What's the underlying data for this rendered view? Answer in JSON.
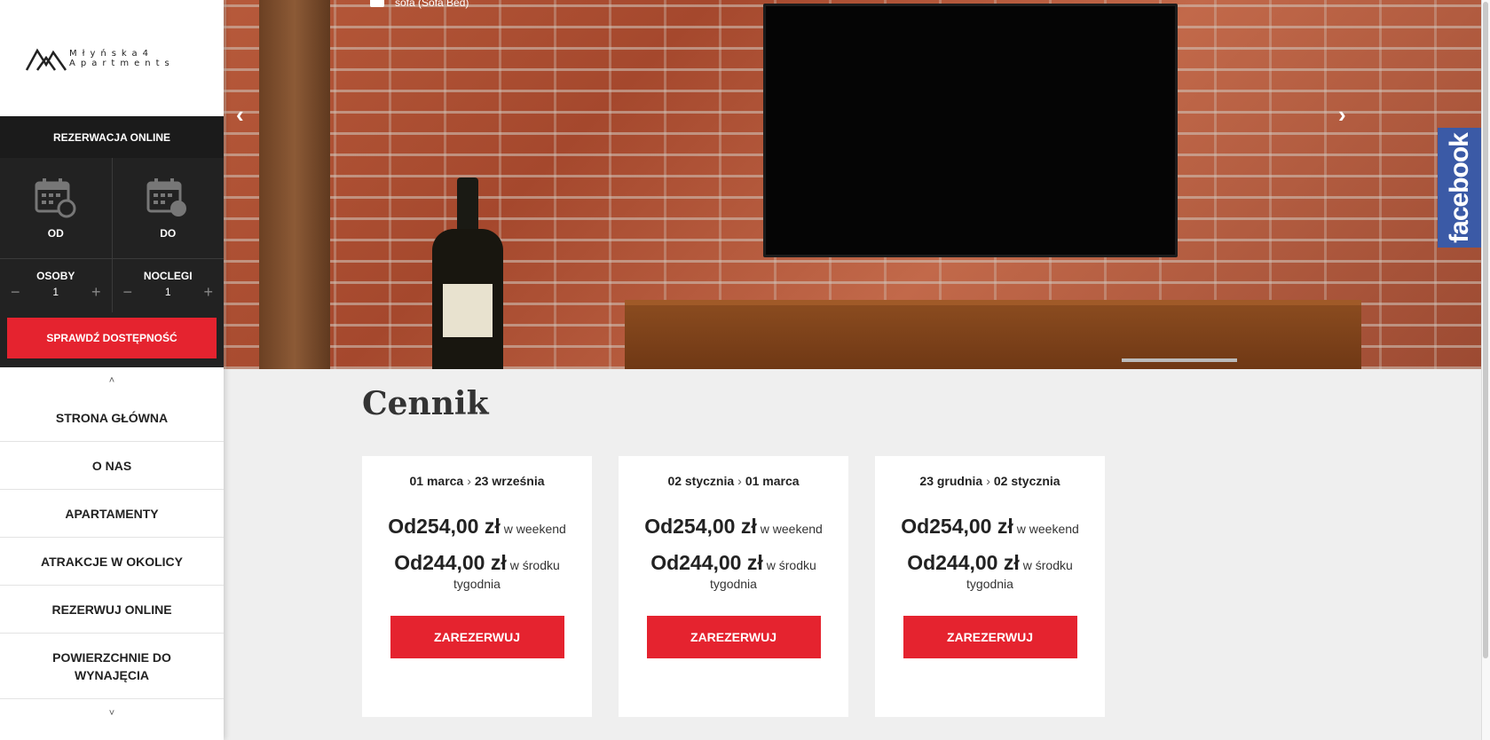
{
  "sidebar": {
    "logo": {
      "line1": "Młyńska4",
      "line2": "Apartments"
    },
    "booking": {
      "header": "REZERWACJA ONLINE",
      "from_label": "OD",
      "to_label": "DO",
      "persons_label": "OSOBY",
      "persons_value": "1",
      "nights_label": "NOCLEGI",
      "nights_value": "1",
      "minus": "−",
      "plus": "+",
      "check_button": "SPRAWDŹ DOSTĘPNOŚĆ"
    },
    "caret_up": "˄",
    "caret_down": "˅",
    "nav": [
      {
        "label": "STRONA GŁÓWNA"
      },
      {
        "label": "O NAS"
      },
      {
        "label": "APARTAMENTY"
      },
      {
        "label": "ATRAKCJE W OKOLICY"
      },
      {
        "label": "REZERWUJ ONLINE"
      },
      {
        "label": "POWIERZCHNIE DO WYNAJĘCIA"
      }
    ]
  },
  "hero": {
    "caption": "sofa (Sofa Bed)",
    "prev_icon": "chevron-left-icon",
    "next_icon": "chevron-right-icon"
  },
  "facebook": {
    "label": "facebook",
    "color": "#3b5aa6"
  },
  "pricing": {
    "title": "Cennik",
    "cards": [
      {
        "from": "01 marca",
        "to": "23 września",
        "weekend_price": "Od254,00 zł",
        "weekend_label": "w weekend",
        "weekday_price": "Od244,00 zł",
        "weekday_label_1": "w środku",
        "weekday_label_2": "tygodnia",
        "button": "ZAREZERWUJ"
      },
      {
        "from": "02 stycznia",
        "to": "01 marca",
        "weekend_price": "Od254,00 zł",
        "weekend_label": "w weekend",
        "weekday_price": "Od244,00 zł",
        "weekday_label_1": "w środku",
        "weekday_label_2": "tygodnia",
        "button": "ZAREZERWUJ"
      },
      {
        "from": "23 grudnia",
        "to": "02 stycznia",
        "weekend_price": "Od254,00 zł",
        "weekend_label": "w weekend",
        "weekday_price": "Od244,00 zł",
        "weekday_label_1": "w środku",
        "weekday_label_2": "tygodnia",
        "button": "ZAREZERWUJ"
      }
    ]
  },
  "colors": {
    "accent": "#e5232f",
    "dark": "#222222"
  }
}
